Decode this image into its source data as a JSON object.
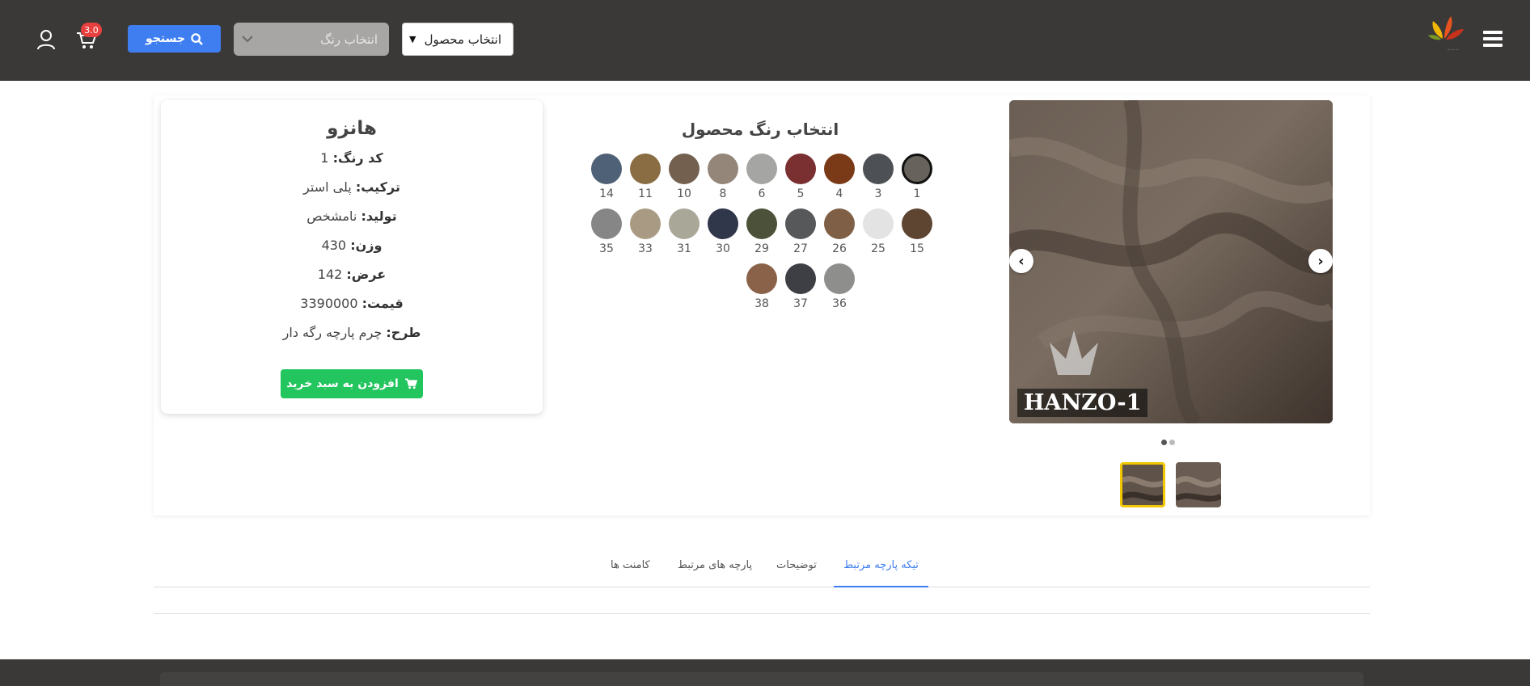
{
  "header": {
    "product_select": "انتخاب محصول",
    "color_select_placeholder": "انتخاب رنگ",
    "search_label": "جستجو",
    "cart_count": "3.0",
    "colors": {
      "bg": "#3b3938",
      "search": "#3e7ef0",
      "badge": "#e7403f"
    }
  },
  "gallery": {
    "image_label": "HANZO-1",
    "slides": 2,
    "active_slide": 1
  },
  "colors_section": {
    "title": "انتخاب رنگ محصول",
    "selected": "1",
    "swatches": [
      {
        "num": "1",
        "color": "#67625c"
      },
      {
        "num": "3",
        "color": "#4d5054"
      },
      {
        "num": "4",
        "color": "#7a3a18"
      },
      {
        "num": "5",
        "color": "#7a2f31"
      },
      {
        "num": "6",
        "color": "#a5a5a3"
      },
      {
        "num": "8",
        "color": "#95867a"
      },
      {
        "num": "10",
        "color": "#73604f"
      },
      {
        "num": "11",
        "color": "#8a6d43"
      },
      {
        "num": "14",
        "color": "#4f6177"
      },
      {
        "num": "15",
        "color": "#5e4532"
      },
      {
        "num": "25",
        "color": "#e3e3e3"
      },
      {
        "num": "26",
        "color": "#7f6047"
      },
      {
        "num": "27",
        "color": "#56585a"
      },
      {
        "num": "29",
        "color": "#4c5139"
      },
      {
        "num": "30",
        "color": "#30374a"
      },
      {
        "num": "31",
        "color": "#a8a798"
      },
      {
        "num": "33",
        "color": "#a99b83"
      },
      {
        "num": "35",
        "color": "#868686"
      },
      {
        "num": "36",
        "color": "#8e8f8c"
      },
      {
        "num": "37",
        "color": "#3e3f44"
      },
      {
        "num": "38",
        "color": "#8a6249"
      }
    ]
  },
  "product": {
    "name": "هانزو",
    "fields": [
      {
        "label": "کد رنگ:",
        "value": "1"
      },
      {
        "label": "ترکیب:",
        "value": "پلی استر"
      },
      {
        "label": "تولید:",
        "value": "نامشخص"
      },
      {
        "label": "وزن:",
        "value": "430"
      },
      {
        "label": "عرض:",
        "value": "142"
      },
      {
        "label": "قیمت:",
        "value": "3390000"
      },
      {
        "label": "طرح:",
        "value": "چرم پارچه رگه دار"
      }
    ],
    "add_to_cart": "افزودن به سبد خرید"
  },
  "tabs": [
    {
      "label": "تیکه پارچه مرتبط",
      "active": true
    },
    {
      "label": "توضیحات",
      "active": false
    },
    {
      "label": "پارچه های مرتبط",
      "active": false
    },
    {
      "label": "کامنت ها",
      "active": false
    }
  ]
}
